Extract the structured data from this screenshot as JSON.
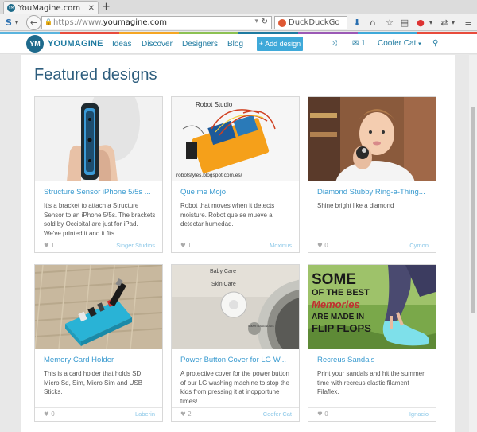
{
  "browser": {
    "tab_title": "YouMagine.com",
    "tab_favicon": "YM",
    "url_proto": "https://www.",
    "url_host": "youmagine.com",
    "search_engine": "DuckDuckGo",
    "colors": [
      "#5ab4de",
      "#e84b3c",
      "#f5a623",
      "#8cc152",
      "#1e7aa0",
      "#9b59b6",
      "#3fa9d9",
      "#e84b3c"
    ]
  },
  "site": {
    "logo_mark": "YM",
    "logo_text": "YOUMAGINE",
    "nav": [
      "Ideas",
      "Discover",
      "Designers",
      "Blog"
    ],
    "add_button": "+ Add design",
    "messages_count": "1",
    "user": "Coofer Cat",
    "brand_color": "#1e7aa0"
  },
  "page_title": "Featured designs",
  "cards": [
    {
      "title": "Structure Sensor iPhone 5/5s ...",
      "desc": "It's a bracket to attach a Structure Sensor to an iPhone 5/5s. The brackets sold by Occipital are just for iPad. We've printed it and it fits",
      "likes": "1",
      "author": "Singer Studios"
    },
    {
      "title": "Que me Mojo",
      "desc": "Robot that moves when it detects moisture. Robot que se mueve al detectar humedad.",
      "likes": "1",
      "author": "Moxinus"
    },
    {
      "title": "Diamond Stubby Ring-a-Thing...",
      "desc": "Shine bright like a diamond",
      "likes": "0",
      "author": "Cymon"
    },
    {
      "title": "Memory Card Holder",
      "desc": "This is a card holder that holds SD, Micro Sd, Sim, Micro Sim and USB Sticks.",
      "likes": "0",
      "author": "Laberin"
    },
    {
      "title": "Power Button Cover for LG W...",
      "desc": "A protective cover for the power button of our LG washing machine to stop the kids from pressing it at inopportune times!",
      "likes": "2",
      "author": "Coofer Cat"
    },
    {
      "title": "Recreus Sandals",
      "desc": "Print your sandals and hit the summer time with recreus elastic filament Filaflex.",
      "likes": "0",
      "author": "Ignacio"
    }
  ],
  "image_text": {
    "robot_label": "Robot Studio",
    "robot_url": "robotstyles.blogspot.com.es/",
    "panel_baby": "Baby Care",
    "panel_skin": "Skin Care",
    "knob_label": "SMART DIAGNOSIS",
    "flipflop_lines": [
      "SOME",
      "OF THE BEST",
      "Memories",
      "ARE MADE IN",
      "FLIP FLOPS"
    ]
  }
}
